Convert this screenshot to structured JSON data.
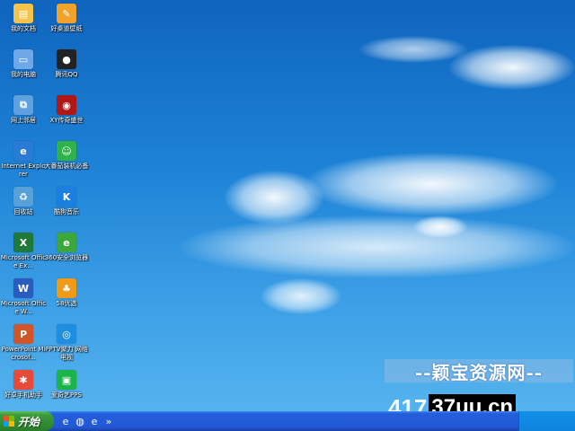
{
  "desktop": {
    "icons": [
      {
        "label": "我的文档",
        "icon": "my-documents-icon",
        "color": "#f3c34a",
        "glyph": "▤"
      },
      {
        "label": "好桌道壁纸",
        "icon": "wallpaper-app-icon",
        "color": "#f0a22a",
        "glyph": "✎"
      },
      {
        "label": "我的电脑",
        "icon": "my-computer-icon",
        "color": "#6ea8e8",
        "glyph": "▭"
      },
      {
        "label": "腾讯QQ",
        "icon": "qq-penguin-icon",
        "color": "#222222",
        "glyph": "●"
      },
      {
        "label": "网上邻居",
        "icon": "network-places-icon",
        "color": "#5fa0de",
        "glyph": "⧉"
      },
      {
        "label": "XY传奇盛世",
        "icon": "game-icon",
        "color": "#b01818",
        "glyph": "◉"
      },
      {
        "label": "Internet Explorer",
        "icon": "internet-explorer-icon",
        "color": "#2a7bd6",
        "glyph": "e"
      },
      {
        "label": "大番茄装机必备",
        "icon": "shopping-bag-icon",
        "color": "#2fb24a",
        "glyph": "☺"
      },
      {
        "label": "回收站",
        "icon": "recycle-bin-icon",
        "color": "#58a0d8",
        "glyph": "♻"
      },
      {
        "label": "酷狗音乐",
        "icon": "kugou-music-icon",
        "color": "#1a7fe0",
        "glyph": "K"
      },
      {
        "label": "Microsoft Office Ex...",
        "icon": "excel-icon",
        "color": "#1f7a3a",
        "glyph": "X"
      },
      {
        "label": "360安全浏览器",
        "icon": "browser-360-icon",
        "color": "#3aa83a",
        "glyph": "e"
      },
      {
        "label": "Microsoft Office W...",
        "icon": "word-icon",
        "color": "#2a5bbf",
        "glyph": "W"
      },
      {
        "label": "58优选",
        "icon": "app-58-icon",
        "color": "#f09a1a",
        "glyph": "♣"
      },
      {
        "label": "PowerPoint Microsof...",
        "icon": "powerpoint-icon",
        "color": "#d2552a",
        "glyph": "P"
      },
      {
        "label": "PPTV聚力 网络电视",
        "icon": "pptv-icon",
        "color": "#1e8ee0",
        "glyph": "◎"
      },
      {
        "label": "好卓手机助手",
        "icon": "phone-assistant-icon",
        "color": "#e84a3a",
        "glyph": "✱"
      },
      {
        "label": "爱奇艺PPS",
        "icon": "iqiyi-icon",
        "color": "#1ab44a",
        "glyph": "▣"
      }
    ]
  },
  "taskbar": {
    "start_label": "开始",
    "quick_launch": [
      {
        "name": "ie-quicklaunch-icon",
        "glyph": "e"
      },
      {
        "name": "media-quicklaunch-icon",
        "glyph": "◍"
      },
      {
        "name": "ie2-quicklaunch-icon",
        "glyph": "e"
      },
      {
        "name": "more-quicklaunch-icon",
        "glyph": "»"
      }
    ]
  },
  "watermark": {
    "line1": "--颖宝资源网--",
    "num": "417",
    "domain": "37uu.cn"
  }
}
